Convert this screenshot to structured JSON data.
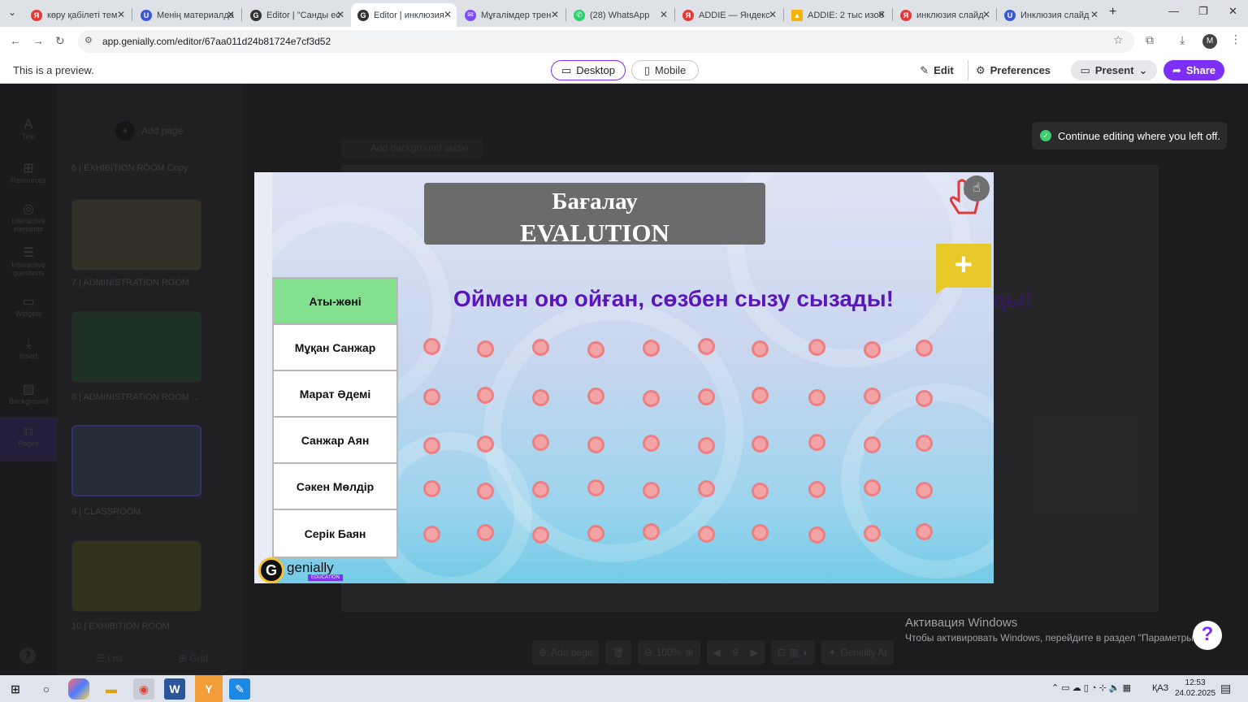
{
  "browser": {
    "tabs": [
      {
        "title": "көру қабілеті тем",
        "icon": "Я",
        "color": "#e53935"
      },
      {
        "title": "Менің материалда",
        "icon": "U",
        "color": "#3b57d6"
      },
      {
        "title": "Editor | \"Санды ес",
        "icon": "G",
        "color": "#333333"
      },
      {
        "title": "Editor | инклюзия",
        "icon": "G",
        "color": "#333333"
      },
      {
        "title": "Мұғалімдер трен",
        "icon": "✉",
        "color": "#7c4dff"
      },
      {
        "title": "(28) WhatsApp",
        "icon": "✆",
        "color": "#25d366"
      },
      {
        "title": "ADDIE — Яндекс",
        "icon": "Я",
        "color": "#e53935"
      },
      {
        "title": "ADDIE: 2 тыс изоб",
        "icon": "▲",
        "color": "#f4b400"
      },
      {
        "title": "инклюзия слайд",
        "icon": "Я",
        "color": "#e53935"
      },
      {
        "title": "Инклюзия слайд",
        "icon": "U",
        "color": "#3b57d6"
      }
    ],
    "url": "app.genially.com/editor/67aa011d24b81724e7cf3d52",
    "profile_initial": "M"
  },
  "preview_bar": {
    "label": "This is a preview.",
    "desktop": "Desktop",
    "mobile": "Mobile",
    "edit": "Edit",
    "preferences": "Preferences",
    "present": "Present",
    "share": "Share",
    "accent": "#7b2ff7"
  },
  "sidebar": {
    "items": [
      "Text",
      "Resources",
      "Interactive elements",
      "Interactive questions",
      "Widgets",
      "Insert",
      "Background",
      "Pages"
    ]
  },
  "pages_panel": {
    "add_page": "Add page",
    "add_audio": "Add background audio",
    "labels": [
      "6 | EXHIBITION ROOM Copy",
      "7 | ADMINISTRATION ROOM",
      "8 | ADMINISTRATION ROOM ...",
      "9 | CLASSROOM",
      "10 | EXHIBITION ROOM"
    ],
    "list": "List",
    "grid": "Grid"
  },
  "toast": "Continue editing where you left off.",
  "slide": {
    "title_line1": "Бағалау",
    "title_line2": "EVALUTION",
    "motto": "Оймен ою ойған, сөзбен сызу сызады!",
    "names": [
      "Аты-жөні",
      "Мұқан Санжар",
      "Марат Әдемі",
      "Санжар Аян",
      "Сәкен Мөлдір",
      "Серік Баян"
    ],
    "ghost_motto_tail": "ды!",
    "logo": "genially",
    "logo_sub": "EDUCATION"
  },
  "bottom_toolbar": {
    "add_page": "Add page",
    "zoom": "100%",
    "page": "9",
    "ai": "Genially AI"
  },
  "windows": {
    "activation_title": "Активация Windows",
    "activation_text": "Чтобы активировать Windows, перейдите в раздел \"Параметры\".",
    "lang": "ҚАЗ",
    "time": "12:53",
    "date": "24.02.2025"
  }
}
